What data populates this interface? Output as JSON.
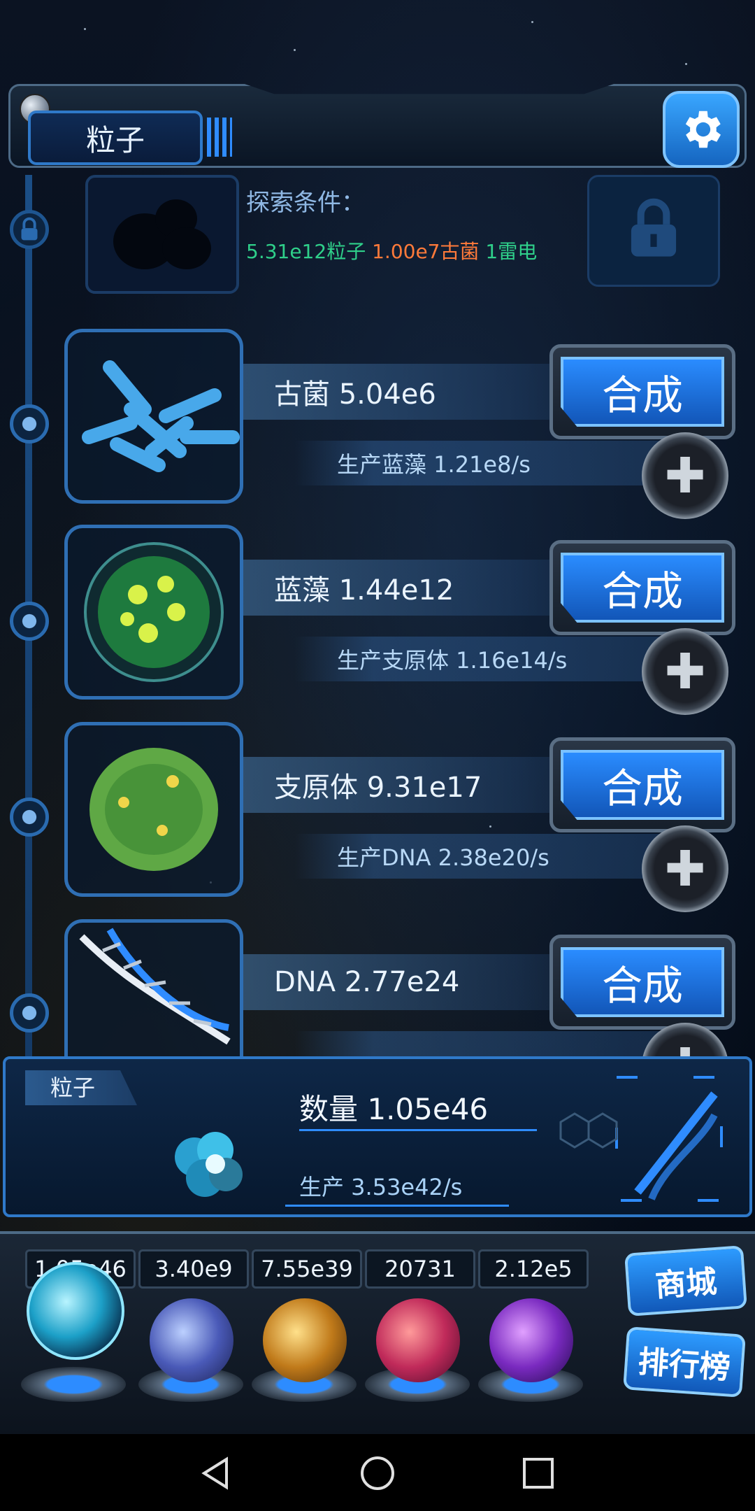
{
  "header": {
    "title": "粒子"
  },
  "locked_item": {
    "label": "探索条件：",
    "cond_particles": "5.31e12粒子",
    "cond_archaea": "1.00e7古菌",
    "cond_thunder": "1雷电"
  },
  "items": [
    {
      "name": "古菌 5.04e6",
      "produce": "生产蓝藻 1.21e8/s",
      "button": "合成"
    },
    {
      "name": "蓝藻 1.44e12",
      "produce": "生产支原体 1.16e14/s",
      "button": "合成"
    },
    {
      "name": "支原体 9.31e17",
      "produce": "生产DNA 2.38e20/s",
      "button": "合成"
    },
    {
      "name": "DNA 2.77e24",
      "produce": "",
      "button": "合成"
    }
  ],
  "panel": {
    "tag": "粒子",
    "quantity": "数量 1.05e46",
    "production": "生产 3.53e42/s"
  },
  "currencies": [
    {
      "value": "1.05e46",
      "icon": "particle-orb-icon"
    },
    {
      "value": "3.40e9",
      "icon": "lightning-orb-icon"
    },
    {
      "value": "7.55e39",
      "icon": "galaxy-orb-icon"
    },
    {
      "value": "20731",
      "icon": "brain-orb-icon"
    },
    {
      "value": "2.12e5",
      "icon": "vortex-orb-icon"
    }
  ],
  "side_buttons": {
    "shop": "商城",
    "ranking": "排行榜"
  },
  "colors": {
    "accent": "#2f8cff",
    "cond_particles": "#2fd08a",
    "cond_archaea": "#ff7a3a",
    "cond_thunder": "#2fd08a"
  }
}
